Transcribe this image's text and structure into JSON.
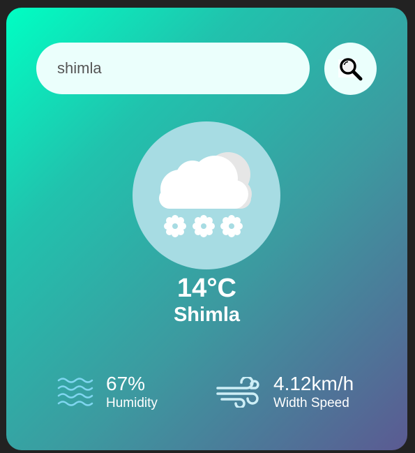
{
  "search": {
    "value": "shimla",
    "icon": "search-icon"
  },
  "weather": {
    "icon": "snow-cloud-icon",
    "temperature": "14°C",
    "city": "Shimla"
  },
  "stats": {
    "humidity_value": "67%",
    "humidity_label": "Humidity",
    "humidity_icon": "humidity-waves-icon",
    "wind_value": "4.12km/h",
    "wind_label": "Width Speed",
    "wind_icon": "wind-icon"
  },
  "colors": {
    "gradient_start": "#00ffc3",
    "gradient_end": "#5b5a92",
    "input_bg": "#ebfffc",
    "icon_circle": "#a7dce3"
  }
}
